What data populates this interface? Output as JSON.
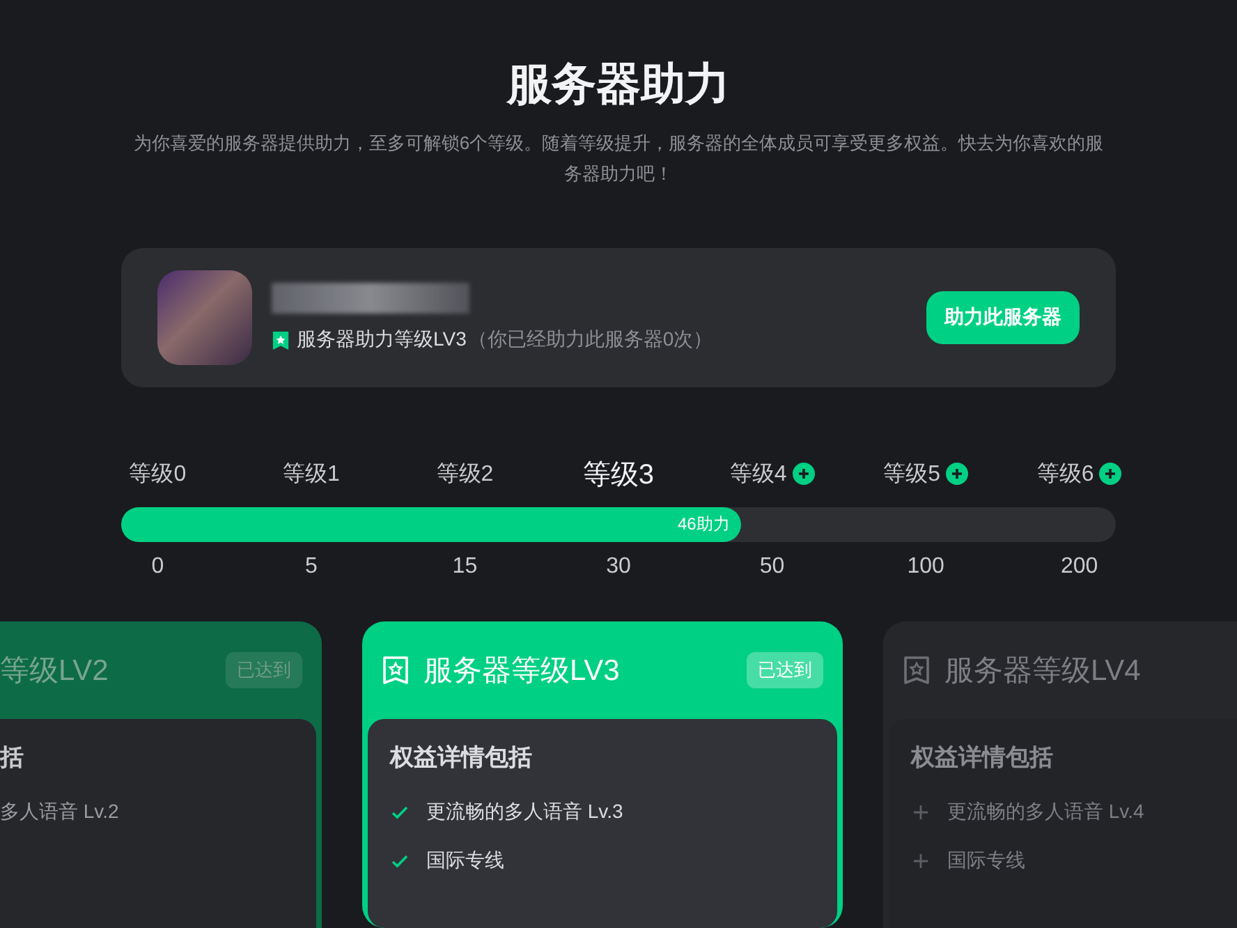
{
  "title": "服务器助力",
  "subtitle": "为你喜爱的服务器提供助力，至多可解锁6个等级。随着等级提升，服务器的全体成员可享受更多权益。快去为你喜欢的服务器助力吧！",
  "server": {
    "level_text": "服务器助力等级LV3",
    "boost_note": "（你已经助力此服务器0次）",
    "button": "助力此服务器"
  },
  "progress": {
    "level": 0.623,
    "fill_label": "46助力",
    "tiers": [
      {
        "label": "等级0",
        "value": "0",
        "selected": false,
        "locked": false
      },
      {
        "label": "等级1",
        "value": "5",
        "selected": false,
        "locked": false
      },
      {
        "label": "等级2",
        "value": "15",
        "selected": false,
        "locked": false
      },
      {
        "label": "等级3",
        "value": "30",
        "selected": true,
        "locked": false
      },
      {
        "label": "等级4",
        "value": "50",
        "selected": false,
        "locked": true
      },
      {
        "label": "等级5",
        "value": "100",
        "selected": false,
        "locked": true
      },
      {
        "label": "等级6",
        "value": "200",
        "selected": false,
        "locked": true
      }
    ]
  },
  "cards": [
    {
      "kind": "past",
      "title": "等级LV2",
      "badge": "已达到",
      "section": "括",
      "benefits": [
        {
          "text": "多人语音 Lv.2"
        }
      ]
    },
    {
      "kind": "current",
      "title": "服务器等级LV3",
      "badge": "已达到",
      "section": "权益详情包括",
      "benefits": [
        {
          "text": "更流畅的多人语音 Lv.3",
          "unlocked": true
        },
        {
          "text": "国际专线",
          "unlocked": true
        }
      ]
    },
    {
      "kind": "locked",
      "title": "服务器等级LV4",
      "section": "权益详情包括",
      "benefits": [
        {
          "text": "更流畅的多人语音 Lv.4",
          "unlocked": false
        },
        {
          "text": "国际专线",
          "unlocked": false
        }
      ]
    }
  ]
}
